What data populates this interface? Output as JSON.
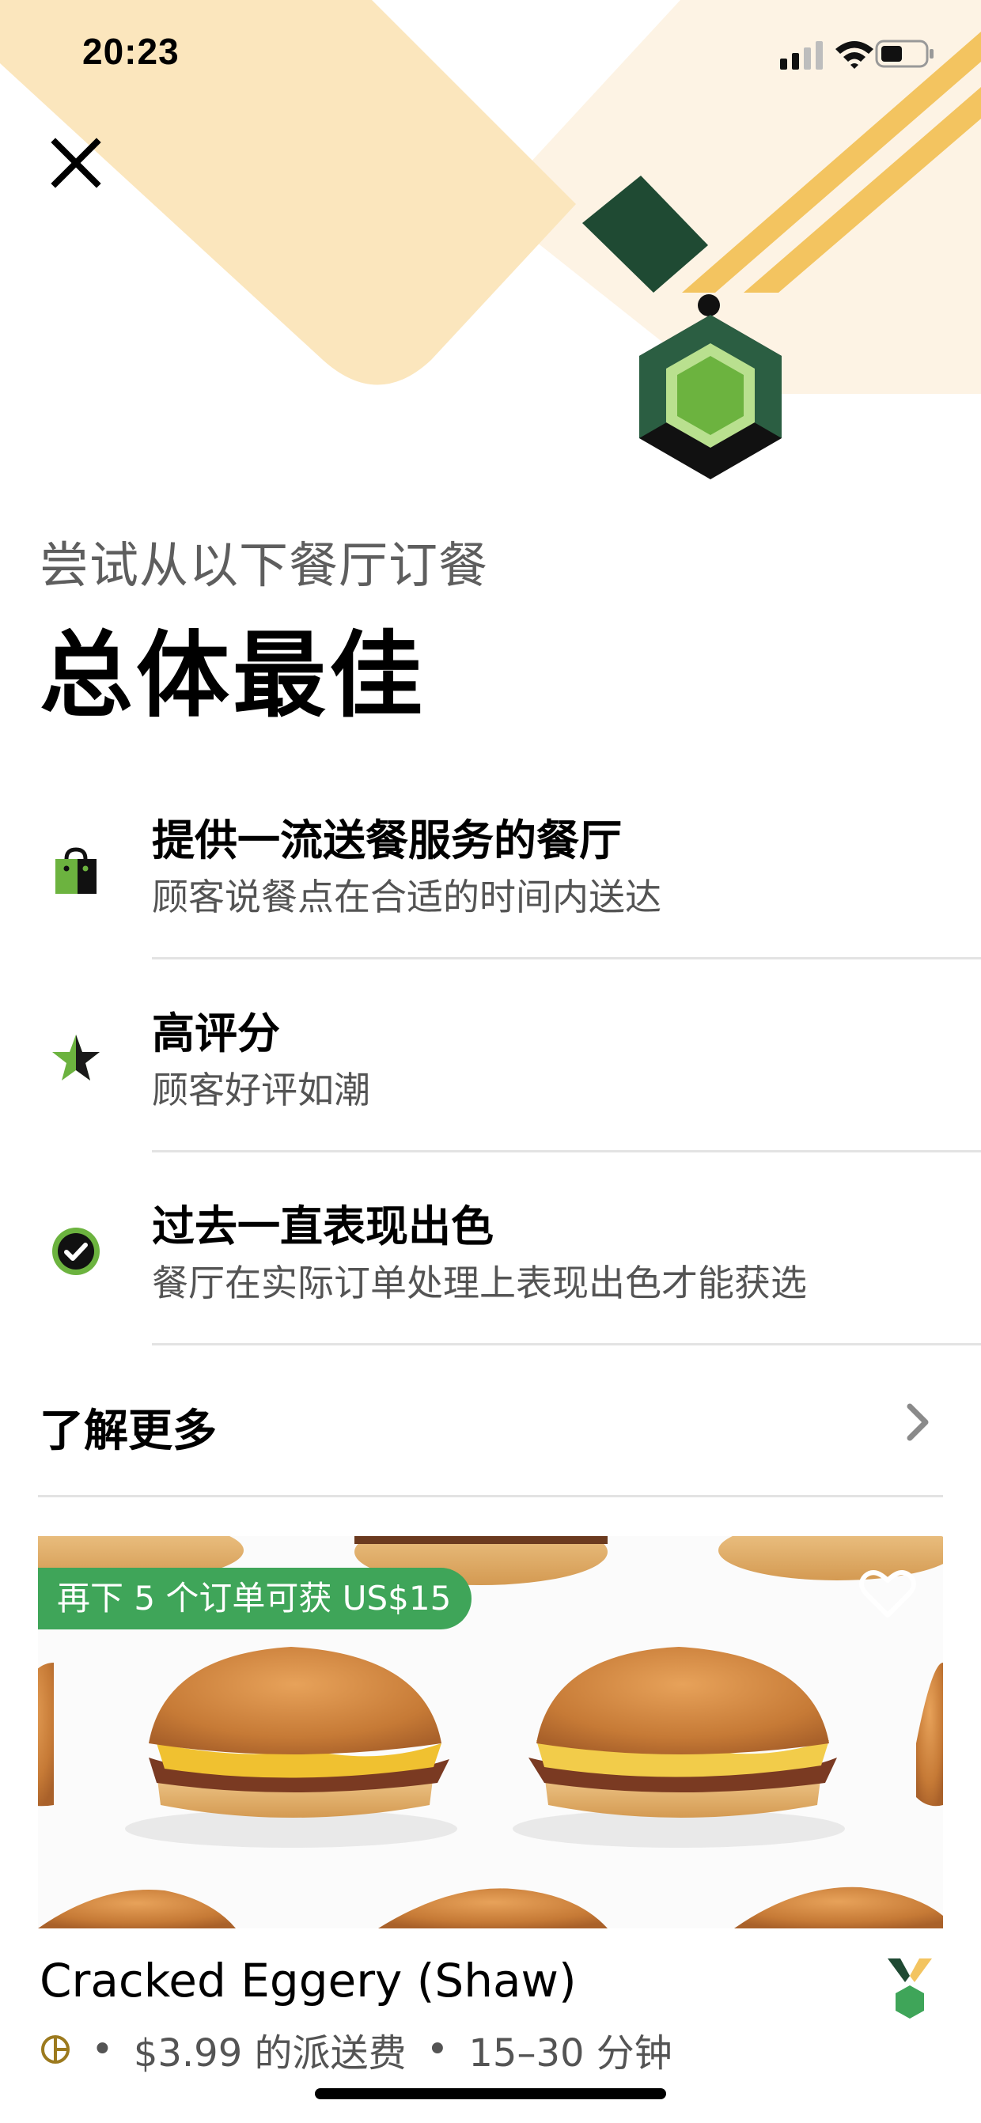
{
  "status_bar": {
    "time": "20:23"
  },
  "header": {
    "subtitle": "尝试从以下餐厅订餐",
    "title": "总体最佳"
  },
  "features": [
    {
      "icon": "shopping-bag-icon",
      "title": "提供一流送餐服务的餐厅",
      "description": "顾客说餐点在合适的时间内送达"
    },
    {
      "icon": "star-icon",
      "title": "高评分",
      "description": "顾客好评如潮"
    },
    {
      "icon": "check-circle-icon",
      "title": "过去一直表现出色",
      "description": "餐厅在实际订单处理上表现出色才能获选"
    }
  ],
  "learn_more": {
    "label": "了解更多"
  },
  "restaurant": {
    "promo": "再下 5 个订单可获 US$15",
    "name": "Cracked Eggery (Shaw)",
    "fee": "$3.99 的派送费",
    "time": "15–30 分钟",
    "separator": "•"
  },
  "colors": {
    "hero_cream": "#fbe6bd",
    "hero_light": "#fdf3e4",
    "hero_yellow": "#f3c460",
    "dark_green": "#1f4a33",
    "accent_green": "#6cb33f",
    "promo_green": "#3fa559"
  }
}
